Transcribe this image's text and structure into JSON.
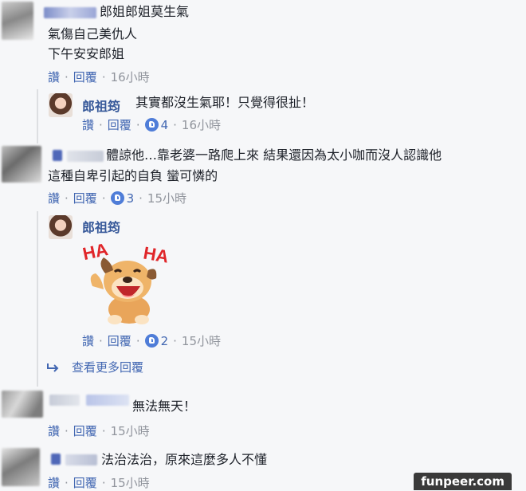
{
  "comments": [
    {
      "name": "郎姐郎姐莫生氣",
      "lines": [
        "氣傷自己美仇人",
        "下午安安郎姐"
      ],
      "like_label": "讚",
      "reply_label": "回覆",
      "time": "16小時",
      "replies": [
        {
          "name": "郎祖筠",
          "text": "其實都沒生氣耶！只覺得很扯！",
          "like_label": "讚",
          "reply_label": "回覆",
          "likes": "4",
          "time": "16小時"
        }
      ]
    },
    {
      "name": "",
      "lines": [
        "體諒他…靠老婆一路爬上來 結果還因為太小咖而沒人認識他",
        "這種自卑引起的自負 蠻可憐的"
      ],
      "like_label": "讚",
      "reply_label": "回覆",
      "likes": "3",
      "time": "15小時",
      "replies": [
        {
          "name": "郎祖筠",
          "sticker": "HA HA dog sticker",
          "sticker_text_left": "HA",
          "sticker_text_right": "HA",
          "like_label": "讚",
          "reply_label": "回覆",
          "likes": "2",
          "time": "15小時"
        }
      ],
      "more_replies": "查看更多回覆"
    },
    {
      "name": "",
      "lines": [
        "無法無天！"
      ],
      "like_label": "讚",
      "reply_label": "回覆",
      "time": "15小時"
    },
    {
      "name": "",
      "lines": [
        "法治法治，原來這麼多人不懂"
      ],
      "like_label": "讚",
      "reply_label": "回覆",
      "time": "15小時"
    }
  ],
  "watermark": "funpeer.com",
  "colors": {
    "link": "#4267b2",
    "name": "#365899",
    "meta": "#90949c",
    "bg": "#f6f7f9"
  }
}
